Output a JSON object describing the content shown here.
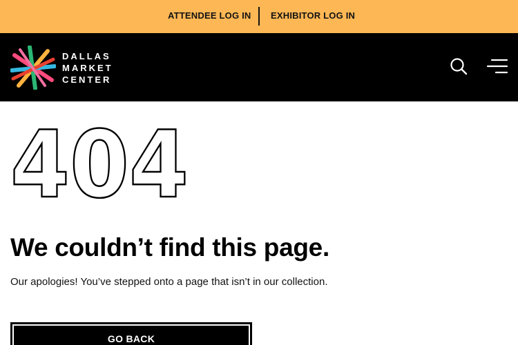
{
  "topbar": {
    "attendee_login": "ATTENDEE LOG IN",
    "exhibitor_login": "EXHIBITOR LOG IN",
    "background": "#fdb755"
  },
  "header": {
    "logo_lines": [
      "DALLAS",
      "MARKET",
      "CENTER"
    ],
    "icons": [
      "search-icon",
      "menu-icon"
    ],
    "background": "#000000"
  },
  "error": {
    "code": "404",
    "heading": "We couldn’t find this page.",
    "message": "Our apologies! You’ve stepped onto a page that isn’t in our collection.",
    "button_label": "GO BACK"
  }
}
